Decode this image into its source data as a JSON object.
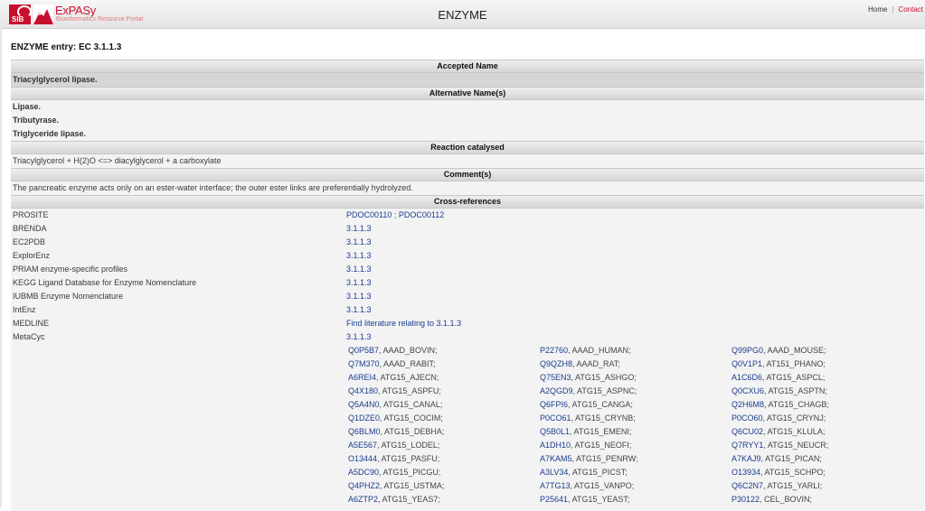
{
  "header": {
    "logo_sib": "SIB",
    "logo_brand": "ExPASy",
    "logo_tagline": "Bioinformatics Resource Portal",
    "title": "ENZYME",
    "nav_home": "Home",
    "nav_sep": "|",
    "nav_contact": "Contact"
  },
  "entry_title": "ENZYME entry: EC 3.1.1.3",
  "sections": {
    "accepted_name": "Accepted Name",
    "alternative_names": "Alternative Name(s)",
    "reaction": "Reaction catalysed",
    "comments": "Comment(s)",
    "cross_refs": "Cross-references"
  },
  "accepted_name": "Triacylglycerol lipase.",
  "alternative_names": [
    "Lipase.",
    "Tributyrase.",
    "Triglyceride lipase."
  ],
  "reaction": "Triacylglycerol + H(2)O <=> diacylglycerol + a carboxylate",
  "comment": "The pancreatic enzyme acts only on an ester-water interface; the outer ester links are preferentially hydrolyzed.",
  "xrefs": [
    {
      "name": "PROSITE",
      "value": "PDOC00110",
      "value2": "PDOC00112",
      "sep": " ; "
    },
    {
      "name": "BRENDA",
      "value": "3.1.1.3"
    },
    {
      "name": "EC2PDB",
      "value": "3.1.1.3"
    },
    {
      "name": "ExplorEnz",
      "value": "3.1.1.3"
    },
    {
      "name": "PRIAM enzyme-specific profiles",
      "value": "3.1.1.3"
    },
    {
      "name": "KEGG Ligand Database for Enzyme Nomenclature",
      "value": "3.1.1.3"
    },
    {
      "name": "IUBMB Enzyme Nomenclature",
      "value": "3.1.1.3"
    },
    {
      "name": "IntEnz",
      "value": "3.1.1.3"
    },
    {
      "name": "MEDLINE",
      "value": "Find literature relating to 3.1.1.3"
    },
    {
      "name": "MetaCyc",
      "value": "3.1.1.3"
    }
  ],
  "uniprot": [
    [
      {
        "acc": "Q0P5B7",
        "name": ", AAAD_BOVIN;"
      },
      {
        "acc": "P22760",
        "name": ", AAAD_HUMAN;"
      },
      {
        "acc": "Q99PG0",
        "name": ", AAAD_MOUSE;"
      }
    ],
    [
      {
        "acc": "Q7M370",
        "name": ", AAAD_RABIT;"
      },
      {
        "acc": "Q9QZH8",
        "name": ", AAAD_RAT;"
      },
      {
        "acc": "Q0V1P1",
        "name": ", AT151_PHANO;"
      }
    ],
    [
      {
        "acc": "A6REI4",
        "name": ", ATG15_AJECN;"
      },
      {
        "acc": "Q75EN3",
        "name": ", ATG15_ASHGO;"
      },
      {
        "acc": "A1C6D6",
        "name": ", ATG15_ASPCL;"
      }
    ],
    [
      {
        "acc": "Q4X180",
        "name": ", ATG15_ASPFU;"
      },
      {
        "acc": "A2QGD9",
        "name": ", ATG15_ASPNC;"
      },
      {
        "acc": "Q0CXU6",
        "name": ", ATG15_ASPTN;"
      }
    ],
    [
      {
        "acc": "Q5A4N0",
        "name": ", ATG15_CANAL;"
      },
      {
        "acc": "Q6FPI6",
        "name": ", ATG15_CANGA;"
      },
      {
        "acc": "Q2H6M8",
        "name": ", ATG15_CHAGB;"
      }
    ],
    [
      {
        "acc": "Q1DZE0",
        "name": ", ATG15_COCIM;"
      },
      {
        "acc": "P0CO61",
        "name": ", ATG15_CRYNB;"
      },
      {
        "acc": "P0CO60",
        "name": ", ATG15_CRYNJ;"
      }
    ],
    [
      {
        "acc": "Q6BLM0",
        "name": ", ATG15_DEBHA;"
      },
      {
        "acc": "Q5B0L1",
        "name": ", ATG15_EMENI;"
      },
      {
        "acc": "Q6CU02",
        "name": ", ATG15_KLULA;"
      }
    ],
    [
      {
        "acc": "A5E567",
        "name": ", ATG15_LODEL;"
      },
      {
        "acc": "A1DH10",
        "name": ", ATG15_NEOFI;"
      },
      {
        "acc": "Q7RYY1",
        "name": ", ATG15_NEUCR;"
      }
    ],
    [
      {
        "acc": "O13444",
        "name": ", ATG15_PASFU;"
      },
      {
        "acc": "A7KAM5",
        "name": ", ATG15_PENRW;"
      },
      {
        "acc": "A7KAJ9",
        "name": ", ATG15_PICAN;"
      }
    ],
    [
      {
        "acc": "A5DC90",
        "name": ", ATG15_PICGU;"
      },
      {
        "acc": "A3LV34",
        "name": ", ATG15_PICST;"
      },
      {
        "acc": "O13934",
        "name": ", ATG15_SCHPO;"
      }
    ],
    [
      {
        "acc": "Q4PHZ2",
        "name": ", ATG15_USTMA;"
      },
      {
        "acc": "A7TG13",
        "name": ", ATG15_VANPO;"
      },
      {
        "acc": "Q6C2N7",
        "name": ", ATG15_YARLI;"
      }
    ],
    [
      {
        "acc": "A6ZTP2",
        "name": ", ATG15_YEAS7;"
      },
      {
        "acc": "P25641",
        "name": ", ATG15_YEAST;"
      },
      {
        "acc": "P30122",
        "name": ", CEL_BOVIN;"
      }
    ]
  ]
}
